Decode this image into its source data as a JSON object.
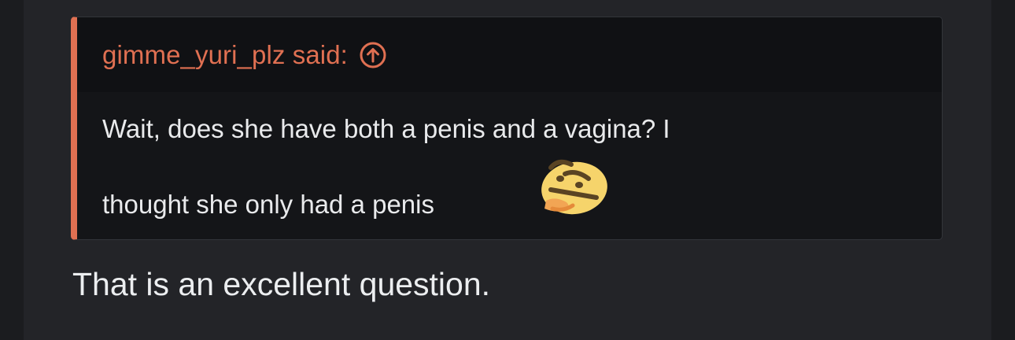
{
  "quote": {
    "author_line": "gimme_yuri_plz said:",
    "body_line1": "Wait, does she have both a penis and a vagina? I",
    "body_line2": "thought she only had a penis",
    "emoji": "thinking-emoji"
  },
  "reply": {
    "text": "That is an excellent question."
  },
  "colors": {
    "accent": "#e07052",
    "background": "#1b1c1f",
    "post_background": "#232428",
    "quote_background": "#141518",
    "quote_header_background": "#101114",
    "text": "#e9eaec"
  }
}
